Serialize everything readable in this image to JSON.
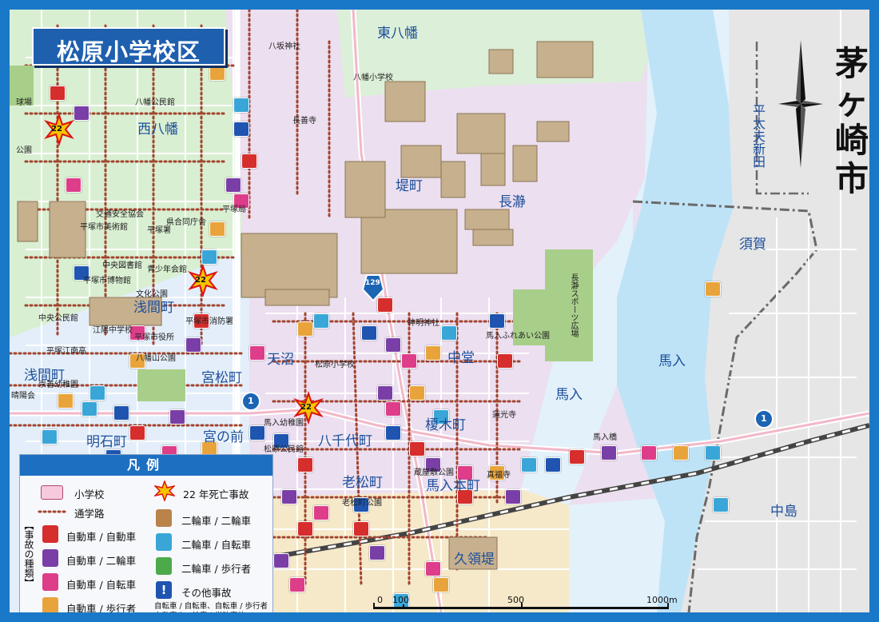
{
  "title": "松原小学校区",
  "city": "茅ヶ崎市",
  "map": {
    "fatal_marker": "22",
    "routes": [
      "129",
      "1"
    ],
    "areas": {
      "higashi_hachiman": "東八幡",
      "nishi_hachiman": "西八幡",
      "tsutsumicho": "堤町",
      "nagatoro": "長瀞",
      "suka": "須賀",
      "asamacho": "浅間町",
      "amanuma": "天沼",
      "nakado": "中堂",
      "miyamatsucho": "宮松町",
      "umairi": "馬入",
      "enokicho": "榎木町",
      "yachiyocho": "八千代町",
      "miyanomae": "宮の前",
      "akashicho": "明石町",
      "oimatsucho": "老松町",
      "umairi_honcho": "馬入本町",
      "nakajima": "中島",
      "kusakitei": "久領堤",
      "hirataiyushinden": "平太夫新田"
    },
    "facilities": {
      "hachiman_shrine": "八坂神社",
      "hachiman_es": "八幡小学校",
      "hachiman_hall": "八幡公民館",
      "chozenji": "長善寺",
      "baseball": "球場",
      "park": "公園",
      "traffic_assoc": "交通安全協会",
      "pref_gov": "県合同庁舎",
      "post_office": "平塚局",
      "art_museum": "平塚市美術館",
      "police": "平塚署",
      "central_library": "中央図書館",
      "youth_hall": "青少年会館",
      "museum": "平塚市博物館",
      "culture_hall": "文化公園",
      "central_community": "中央公民館",
      "fire_dept": "平塚市消防署",
      "konan_jhs": "江陽中学校",
      "city_hall": "平塚市役所",
      "hiratsuka_hs": "平塚江南高",
      "yahatayama_park": "八幡山公園",
      "sozen_kindergarten": "崇善幼稚園",
      "seikaen": "晴陽会",
      "shinmei_shrine": "神明神社",
      "umairi_park": "馬入ふれあい公園",
      "matsubara_es": "松原小学校",
      "unkoji": "蓮光寺",
      "umairi_kindergarten": "馬入幼稚園",
      "matsubara_community": "松原公民館",
      "umairi_bridge": "馬入橋",
      "umairi_honcho_park": "蔵屋敷公園",
      "shinpukuji": "真福寺",
      "oimatsu_park": "老松町公園",
      "nagatoro_sports": "長瀞スポーツ広場"
    }
  },
  "scale": [
    "0",
    "100",
    "500",
    "1000m"
  ],
  "legend": {
    "title": "凡例",
    "school": "小学校",
    "fatal": "22 年死亡事故",
    "route": "通学路",
    "accident_types": "【事故の種類】",
    "items": [
      "自動車 / 自動車",
      "自動車 / 二輪車",
      "自動車 / 自転車",
      "自動車 / 歩行者",
      "二輪車 / 二輪車",
      "二輪車 / 自転車",
      "二輪車 / 歩行者",
      "その他事故"
    ],
    "note": "自転車 / 自転車、自転車 / 歩行者 自動車や二輪車の単独事故"
  },
  "colors": {
    "frame": "#1a78c8",
    "title_bg": "#1e5fae",
    "route_dots": "#a2442e",
    "car_car": "#d62d2d",
    "car_motorcycle": "#7a3fa6",
    "car_bicycle": "#de3d8a",
    "car_pedestrian": "#e8a43b",
    "motorcycle_motorcycle": "#b9834a",
    "motorcycle_bicycle": "#3aa6d8",
    "motorcycle_pedestrian": "#4daa4a",
    "other": "#1f55b0"
  }
}
